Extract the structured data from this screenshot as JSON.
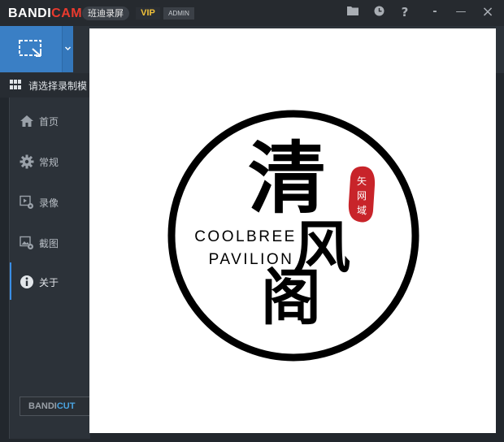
{
  "app": {
    "brand_part1": "BANDI",
    "brand_part2": "CAM",
    "pill_label": "班迪录屏",
    "vip_label": "VIP",
    "admin_label": "ADMIN",
    "accent_color": "#3a7fc5",
    "brand_red": "#ea3a2e"
  },
  "titlebar_buttons": [
    "folder-icon",
    "clock-icon",
    "help-icon",
    "collapse-icon",
    "minimize-icon",
    "close-icon"
  ],
  "titlebar_glyphs": {
    "help": "?",
    "collapse": "-",
    "minimize": "—",
    "close": "×"
  },
  "section": {
    "label": "请选择录制模"
  },
  "sidebar": {
    "items": [
      {
        "label": "首页",
        "icon": "home-icon"
      },
      {
        "label": "常规",
        "icon": "gear-icon"
      },
      {
        "label": "录像",
        "icon": "video-gear-icon"
      },
      {
        "label": "截图",
        "icon": "image-gear-icon"
      },
      {
        "label": "关于",
        "icon": "info-icon",
        "active": true
      }
    ]
  },
  "bandicut": {
    "part1": "BANDI",
    "part2": "CUT"
  },
  "image": {
    "char1": "清",
    "char2": "风",
    "char3": "阁",
    "line1": "COOLBREE",
    "line2": "PAVILION",
    "seal_chars": [
      "矢",
      "网",
      "域"
    ],
    "seal_color": "#c8242a"
  }
}
